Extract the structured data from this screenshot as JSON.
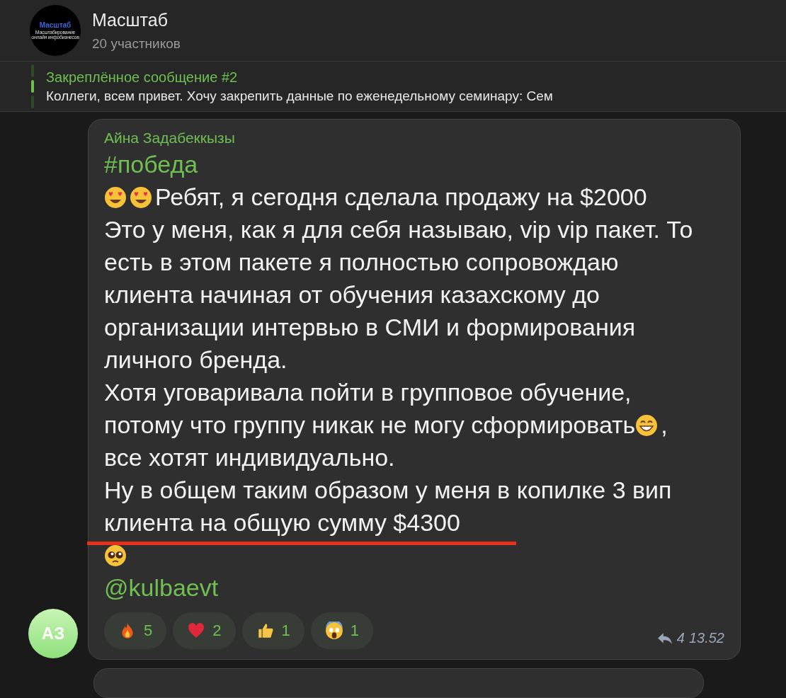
{
  "chat": {
    "avatar": {
      "logo": "Масштаб",
      "tagline": "Масштабирование онлайн инфобизнесов"
    },
    "title": "Масштаб",
    "subtitle": "20 участников"
  },
  "pinned": {
    "title": "Закреплённое сообщение #2",
    "text": "Коллеги, всем привет. Хочу закрепить данные по еженедельному семинару:  Сем"
  },
  "message": {
    "author": "Айна Задабеккызы",
    "avatar_initials": "АЗ",
    "paragraphs": [
      {
        "kind": "link",
        "segments": [
          {
            "kind": "text",
            "text": "#победа"
          }
        ]
      },
      {
        "kind": "plain",
        "segments": [
          {
            "kind": "heart-eyes"
          },
          {
            "kind": "heart-eyes"
          },
          {
            "kind": "text",
            "text": "Ребят, я сегодня сделала продажу на $2000"
          }
        ]
      },
      {
        "kind": "plain",
        "segments": [
          {
            "kind": "text",
            "text": "Это у меня, как я для себя называю, vip vip пакет. То"
          }
        ]
      },
      {
        "kind": "plain",
        "segments": [
          {
            "kind": "text",
            "text": "есть в этом пакете я полностью сопровождаю"
          }
        ]
      },
      {
        "kind": "plain",
        "segments": [
          {
            "kind": "text",
            "text": "клиента начиная от обучения казахскому до"
          }
        ]
      },
      {
        "kind": "plain",
        "segments": [
          {
            "kind": "text",
            "text": "организации интервью в СМИ и формирования"
          }
        ]
      },
      {
        "kind": "plain",
        "segments": [
          {
            "kind": "text",
            "text": "личного бренда."
          }
        ]
      },
      {
        "kind": "plain",
        "segments": [
          {
            "kind": "text",
            "text": "Хотя уговаривала пойти в групповое обучение,"
          }
        ]
      },
      {
        "kind": "plain",
        "segments": [
          {
            "kind": "text",
            "text": "потому что группу никак не могу сформировать"
          },
          {
            "kind": "grin"
          },
          {
            "kind": "text",
            "text": ","
          }
        ]
      },
      {
        "kind": "plain",
        "segments": [
          {
            "kind": "text",
            "text": "все хотят индивидуально."
          }
        ]
      },
      {
        "kind": "plain",
        "segments": [
          {
            "kind": "text",
            "text": "Ну в общем таким образом у меня в копилке 3 вип"
          }
        ]
      },
      {
        "kind": "plain",
        "segments": [
          {
            "kind": "text",
            "text": "клиента на общую сумму $4300"
          }
        ]
      },
      {
        "kind": "plain",
        "segments": [
          {
            "kind": "pleading"
          }
        ]
      },
      {
        "kind": "link",
        "segments": [
          {
            "kind": "text",
            "text": "@kulbaevt"
          }
        ]
      }
    ],
    "reactions": [
      {
        "kind": "fire",
        "count": "5"
      },
      {
        "kind": "heart",
        "count": "2"
      },
      {
        "kind": "thumbs-up",
        "count": "1"
      },
      {
        "kind": "scream",
        "count": "1"
      }
    ],
    "replies": "4",
    "time": "13.52"
  }
}
